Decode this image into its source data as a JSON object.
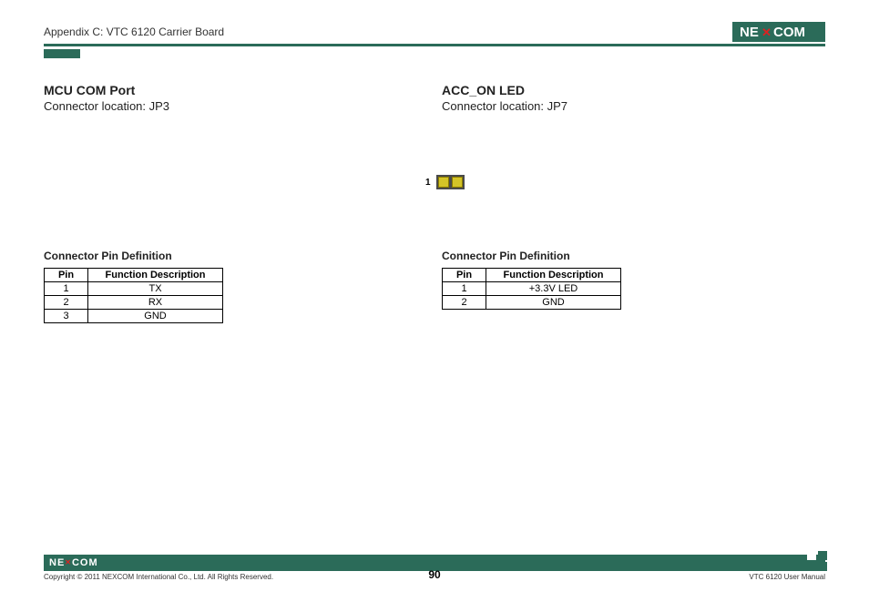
{
  "header": {
    "breadcrumb": "Appendix C: VTC 6120 Carrier Board",
    "logo_text": "NEXCOM"
  },
  "left": {
    "title": "MCU COM Port",
    "location": "Connector location: JP3",
    "table_title": "Connector Pin Definition",
    "headers": {
      "pin": "Pin",
      "func": "Function Description"
    },
    "rows": [
      {
        "pin": "1",
        "func": "TX"
      },
      {
        "pin": "2",
        "func": "RX"
      },
      {
        "pin": "3",
        "func": "GND"
      }
    ]
  },
  "right": {
    "title": "ACC_ON LED",
    "location": "Connector location: JP7",
    "diagram_pin_label": "1",
    "table_title": "Connector Pin Definition",
    "headers": {
      "pin": "Pin",
      "func": "Function Description"
    },
    "rows": [
      {
        "pin": "1",
        "func": "+3.3V LED"
      },
      {
        "pin": "2",
        "func": "GND"
      }
    ]
  },
  "footer": {
    "logo_text": "NE COM",
    "copyright": "Copyright © 2011 NEXCOM International Co., Ltd. All Rights Reserved.",
    "manual": "VTC 6120 User Manual",
    "page": "90"
  }
}
